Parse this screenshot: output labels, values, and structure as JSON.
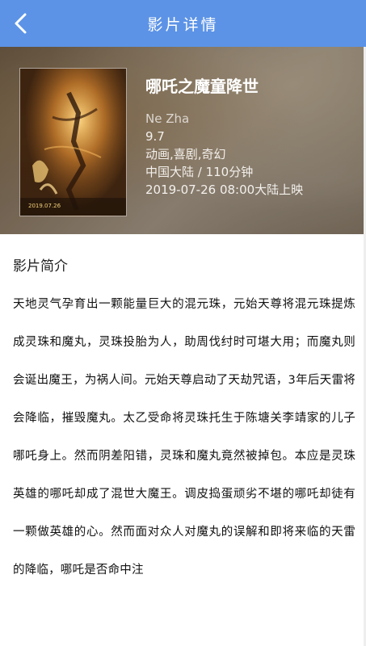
{
  "header": {
    "title": "影片详情",
    "back_icon": "chevron-left-icon"
  },
  "movie": {
    "title": "哪吒之魔童降世",
    "english_title": "Ne Zha",
    "score": "9.7",
    "genres": "动画,喜剧,奇幻",
    "region_duration": "中国大陆 / 110分钟",
    "release": "2019-07-26 08:00大陆上映",
    "poster_date": "2019.07.26"
  },
  "synopsis": {
    "heading": "影片简介",
    "text": "天地灵气孕育出一颗能量巨大的混元珠，元始天尊将混元珠提炼成灵珠和魔丸，灵珠投胎为人，助周伐纣时可堪大用；而魔丸则会诞出魔王，为祸人间。元始天尊启动了天劫咒语，3年后天雷将会降临，摧毁魔丸。太乙受命将灵珠托生于陈塘关李靖家的儿子哪吒身上。然而阴差阳错，灵珠和魔丸竟然被掉包。本应是灵珠英雄的哪吒却成了混世大魔王。调皮捣蛋顽劣不堪的哪吒却徒有一颗做英雄的心。然而面对众人对魔丸的误解和即将来临的天雷的降临，哪吒是否命中注"
  },
  "colors": {
    "header_bg": "#5c93e6",
    "header_text": "#ffffff",
    "body_text": "#111111"
  }
}
